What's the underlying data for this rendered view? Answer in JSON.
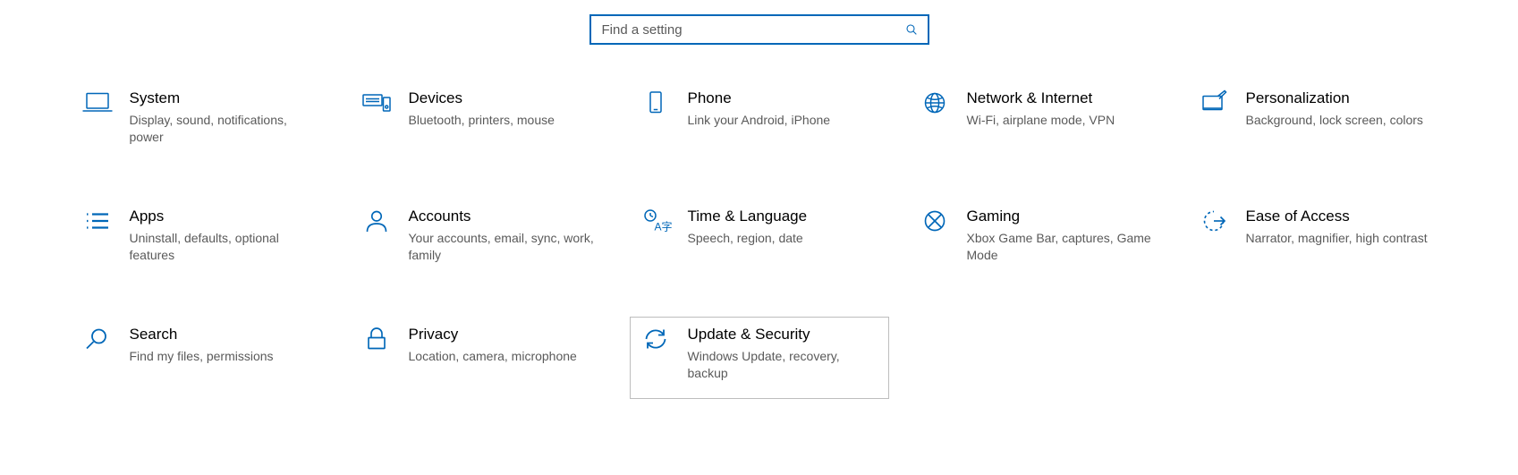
{
  "search": {
    "placeholder": "Find a setting"
  },
  "tiles": [
    {
      "id": "system",
      "title": "System",
      "desc": "Display, sound, notifications, power"
    },
    {
      "id": "devices",
      "title": "Devices",
      "desc": "Bluetooth, printers, mouse"
    },
    {
      "id": "phone",
      "title": "Phone",
      "desc": "Link your Android, iPhone"
    },
    {
      "id": "network",
      "title": "Network & Internet",
      "desc": "Wi-Fi, airplane mode, VPN"
    },
    {
      "id": "personalization",
      "title": "Personalization",
      "desc": "Background, lock screen, colors"
    },
    {
      "id": "apps",
      "title": "Apps",
      "desc": "Uninstall, defaults, optional features"
    },
    {
      "id": "accounts",
      "title": "Accounts",
      "desc": "Your accounts, email, sync, work, family"
    },
    {
      "id": "time",
      "title": "Time & Language",
      "desc": "Speech, region, date"
    },
    {
      "id": "gaming",
      "title": "Gaming",
      "desc": "Xbox Game Bar, captures, Game Mode"
    },
    {
      "id": "ease",
      "title": "Ease of Access",
      "desc": "Narrator, magnifier, high contrast"
    },
    {
      "id": "search",
      "title": "Search",
      "desc": "Find my files, permissions"
    },
    {
      "id": "privacy",
      "title": "Privacy",
      "desc": "Location, camera, microphone"
    },
    {
      "id": "update",
      "title": "Update & Security",
      "desc": "Windows Update, recovery, backup",
      "selected": true
    }
  ]
}
